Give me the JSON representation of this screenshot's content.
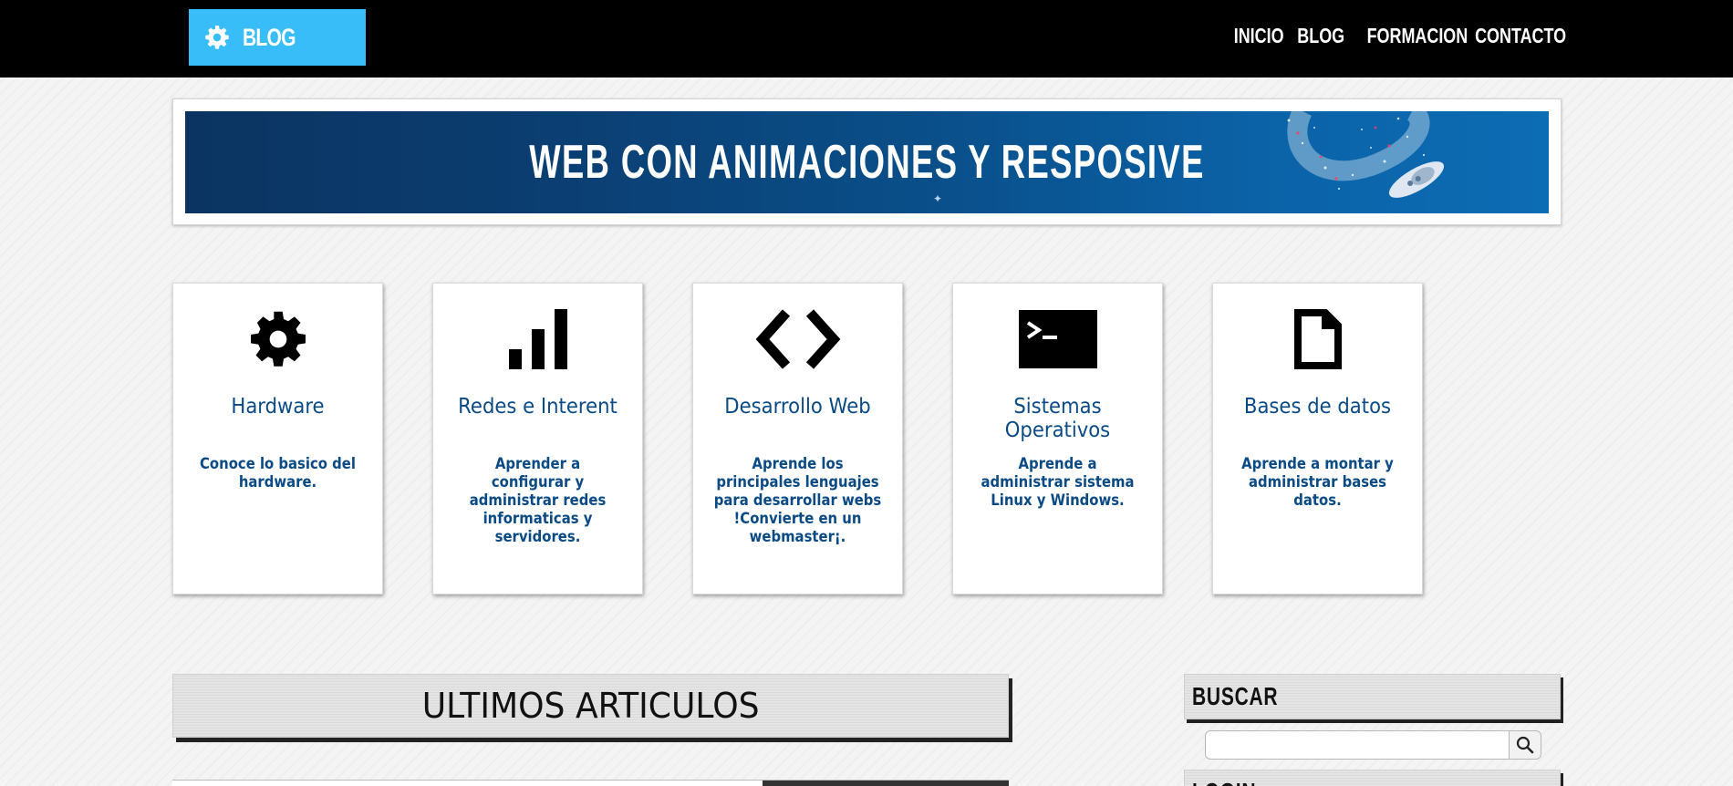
{
  "header": {
    "logo_text": "BLOG",
    "logo_icon": "gear-icon",
    "nav": [
      {
        "label": "INICIO"
      },
      {
        "label": "BLOG"
      },
      {
        "label": "FORMACION"
      },
      {
        "label": "CONTACTO"
      }
    ]
  },
  "banner": {
    "title": "WEB CON ANIMACIONES Y RESPOSIVE"
  },
  "cards": [
    {
      "icon": "gear-icon",
      "title": "Hardware",
      "description": "Conoce lo basico del hardware."
    },
    {
      "icon": "signal-bars-icon",
      "title": "Redes e Interent",
      "description": "Aprender a configurar y administrar redes informaticas y servidores."
    },
    {
      "icon": "code-brackets-icon",
      "title": "Desarrollo Web",
      "description": "Aprende los principales lenguajes para desarrollar webs !Convierte en un webmaster¡."
    },
    {
      "icon": "terminal-icon",
      "title": "Sistemas Operativos",
      "description": "Aprende a administrar sistema Linux y Windows."
    },
    {
      "icon": "file-icon",
      "title": "Bases de datos",
      "description": "Aprende a montar y administrar bases datos."
    }
  ],
  "main": {
    "section_title": "ULTIMOS ARTICULOS"
  },
  "sidebar": {
    "search_title": "BUSCAR",
    "search_value": "",
    "search_icon": "search-icon",
    "login_title": "LOGIN"
  },
  "colors": {
    "topbar": "#000000",
    "logo_bg": "#38bdf8",
    "card_text": "#0a4a85",
    "banner_bg": "#0b3d70"
  }
}
